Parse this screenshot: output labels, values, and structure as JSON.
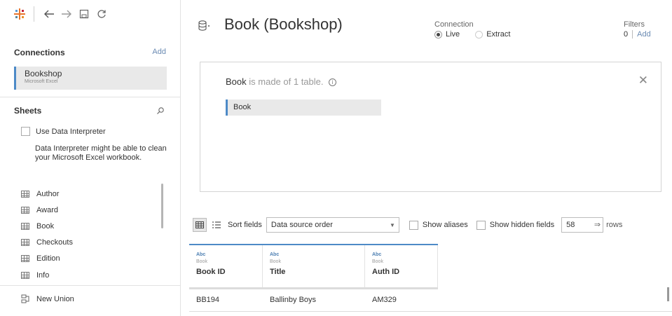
{
  "toolbar": {
    "icons": [
      "tableau-logo-icon",
      "back-arrow-icon",
      "forward-arrow-icon",
      "save-icon",
      "refresh-icon"
    ]
  },
  "connections": {
    "heading": "Connections",
    "add_label": "Add",
    "items": [
      {
        "name": "Bookshop",
        "type": "Microsoft Excel"
      }
    ]
  },
  "sheets": {
    "heading": "Sheets",
    "interpreter_label": "Use Data Interpreter",
    "interpreter_note": "Data Interpreter might be able to clean your Microsoft Excel workbook.",
    "items": [
      {
        "label": "Author"
      },
      {
        "label": "Award"
      },
      {
        "label": "Book"
      },
      {
        "label": "Checkouts"
      },
      {
        "label": "Edition"
      },
      {
        "label": "Info"
      }
    ],
    "new_union_label": "New Union"
  },
  "datasource": {
    "title": "Book (Bookshop)",
    "connection_label": "Connection",
    "live_label": "Live",
    "extract_label": "Extract",
    "connection_selected": "Live",
    "filters_label": "Filters",
    "filters_count": "0",
    "filters_add": "Add"
  },
  "canvas": {
    "table_name": "Book",
    "made_of_text": "is made of 1 table.",
    "info_glyph": "i",
    "close_glyph": "✕",
    "table_pill": "Book"
  },
  "grid_toolbar": {
    "sort_label": "Sort fields",
    "sort_value": "Data source order",
    "sort_caret": "▼",
    "show_aliases": "Show aliases",
    "show_hidden": "Show hidden fields",
    "rows_value": "58",
    "rows_arrow": "⇒",
    "rows_label": "rows"
  },
  "grid": {
    "columns": [
      {
        "type": "Abc",
        "source": "Book",
        "name": "Book ID"
      },
      {
        "type": "Abc",
        "source": "Book",
        "name": "Title"
      },
      {
        "type": "Abc",
        "source": "Book",
        "name": "Auth ID"
      }
    ],
    "rows": [
      [
        "BB194",
        "Ballinby Boys",
        "AM329"
      ]
    ]
  }
}
